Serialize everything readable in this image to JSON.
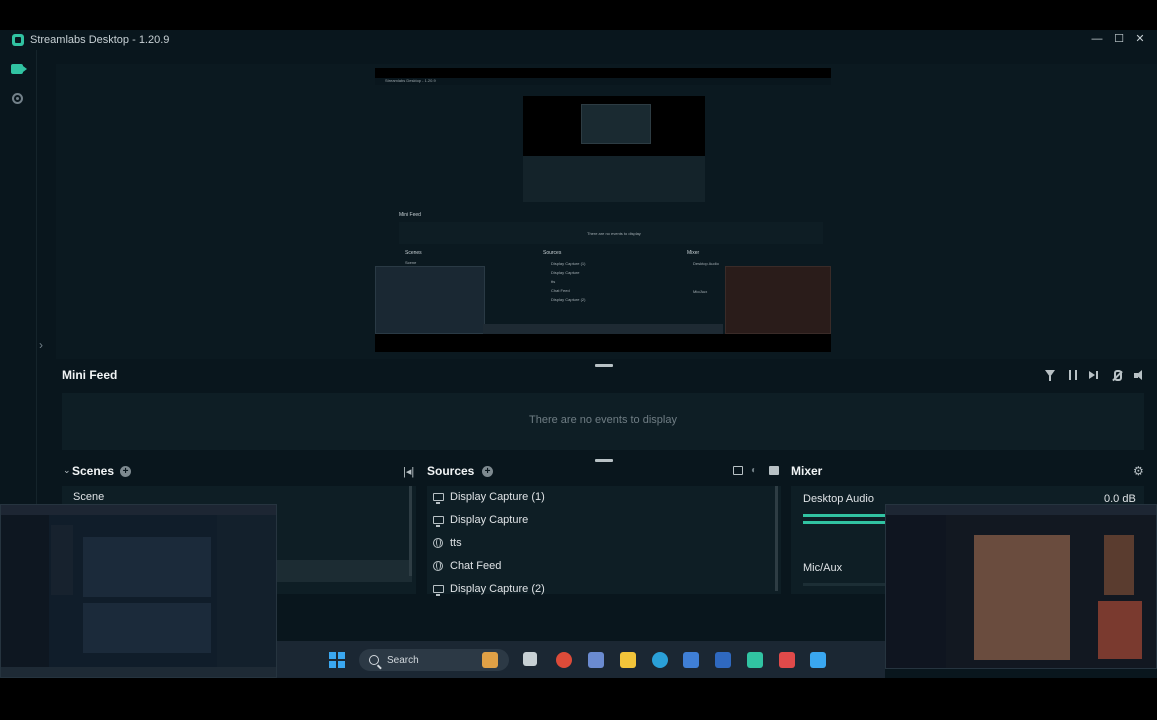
{
  "window": {
    "title": "Streamlabs Desktop - 1.20.9",
    "controls": [
      "minimize",
      "maximize",
      "close"
    ]
  },
  "left_nav": {
    "items": [
      {
        "icon": "camera-icon",
        "name": "editor"
      },
      {
        "icon": "record-icon",
        "name": "recordings"
      }
    ]
  },
  "preview": {
    "nested_title": "Streamlabs Desktop - 1.20.9",
    "nested_minifeed": "Mini Feed",
    "nested_empty": "There are no events to display",
    "nested_scenes": "Scenes",
    "nested_scene": "Scene",
    "nested_sources": "Sources",
    "nested_source_items": [
      "Display Capture (1)",
      "Display Capture",
      "tts",
      "Chat Feed",
      "Display Capture (2)"
    ],
    "nested_mixer": "Mixer",
    "nested_desktop_audio": "Desktop Audio",
    "nested_micaux": "Mic/Aux"
  },
  "mini_feed": {
    "title": "Mini Feed",
    "empty_text": "There are no events to display",
    "tools": [
      "filter-icon",
      "pause-icon",
      "skip-icon",
      "mute-icon",
      "speaker-icon"
    ]
  },
  "scenes": {
    "title": "Scenes",
    "items": [
      "Scene"
    ]
  },
  "sources": {
    "title": "Sources",
    "items": [
      {
        "label": "Display Capture (1)",
        "icon": "monitor-icon"
      },
      {
        "label": "Display Capture",
        "icon": "monitor-icon"
      },
      {
        "label": "tts",
        "icon": "globe-icon"
      },
      {
        "label": "Chat Feed",
        "icon": "globe-icon"
      },
      {
        "label": "Display Capture (2)",
        "icon": "monitor-icon"
      }
    ]
  },
  "mixer": {
    "title": "Mixer",
    "channels": [
      {
        "name": "Desktop Audio",
        "level": "0.0 dB",
        "meter_fraction": 0.28
      },
      {
        "name": "Mic/Aux",
        "level": "",
        "meter_fraction": 0.0
      }
    ]
  },
  "taskbar": {
    "search_placeholder": "Search"
  },
  "colors": {
    "accent": "#31c3a2",
    "background": "#09161d",
    "panel": "#0e1e25"
  }
}
